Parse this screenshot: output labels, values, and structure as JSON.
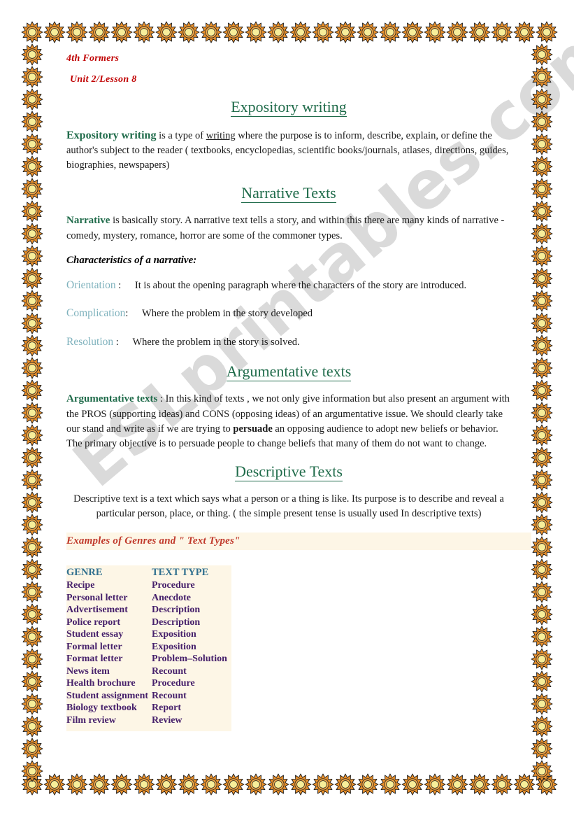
{
  "document": {
    "class_level": "4th Formers",
    "unit_lesson": "Unit 2/Lesson 8",
    "watermark": "ESLprintables.com"
  },
  "sections": {
    "expository": {
      "heading": "Expository writing",
      "lead": "Expository writing",
      "text_before_link": " is a type of ",
      "link_word": "writing",
      "text_after_link": " where the purpose is to inform, describe, explain, or define the author's subject to the reader (  textbooks, encyclopedias, scientific books/journals, atlases, directions, guides, biographies, newspapers)"
    },
    "narrative": {
      "heading": "Narrative Texts",
      "lead": "Narrative",
      "body": " is basically story. A narrative text tells a story, and within this there are many kinds of narrative - comedy, mystery, romance, horror are some of the commoner types.",
      "characteristics_title": "Characteristics of a narrative:",
      "features": [
        {
          "label": "Orientation",
          "separator": ":",
          "text": "It is about the opening paragraph where the characters  of the story are introduced."
        },
        {
          "label": "Complication",
          "separator": ":",
          "text": "Where  the problem in the story developed"
        },
        {
          "label": "Resolution",
          "separator": ":",
          "text": "Where the problem in the story is solved."
        }
      ]
    },
    "argumentative": {
      "heading": "Argumentative texts",
      "lead": "Argumentative texts",
      "text_part1": " : In this kind of texts , we not only give information but also present an argument with the PROS (supporting ideas) and CONS (opposing ideas) of an argumentative issue. We should clearly take our stand and write as if we are trying to ",
      "bold_word": "persuade",
      "text_part2": " an opposing audience to adopt new beliefs or behavior. The primary objective is to persuade people to change beliefs that many of them do not want to change."
    },
    "descriptive": {
      "heading": "Descriptive Texts",
      "body": "Descriptive text is a text which says what a person or a thing is like. Its purpose is to describe and reveal a particular person, place, or thing. (  the simple present  tense  is usually used In descriptive texts)"
    }
  },
  "genre_table": {
    "banner_title": "Examples of Genres and \" Text Types\"",
    "headers": [
      "GENRE",
      "TEXT TYPE"
    ],
    "rows": [
      [
        "Recipe",
        "Procedure"
      ],
      [
        "Personal letter",
        "Anecdote"
      ],
      [
        "Advertisement",
        "Description"
      ],
      [
        "Police report",
        "Description"
      ],
      [
        "Student essay",
        "Exposition"
      ],
      [
        "Formal letter",
        "Exposition"
      ],
      [
        "Format letter",
        "Problem–Solution"
      ],
      [
        "News item",
        "Recount"
      ],
      [
        "Health brochure",
        "Procedure"
      ],
      [
        "Student assignment",
        "Recount"
      ],
      [
        "Biology textbook",
        "Report"
      ],
      [
        "Film review",
        "Review"
      ]
    ]
  },
  "colors": {
    "heading_green": "#1f6b4a",
    "meta_red": "#c00000",
    "feature_teal": "#7fb2bd",
    "table_header_blue": "#31708f",
    "table_row_purple": "#46206b",
    "banner_cream": "#fdf6e6",
    "sun_orange": "#e8902c",
    "sun_center": "#f7ee9a",
    "watermark_gray": "#d9d9d9"
  }
}
